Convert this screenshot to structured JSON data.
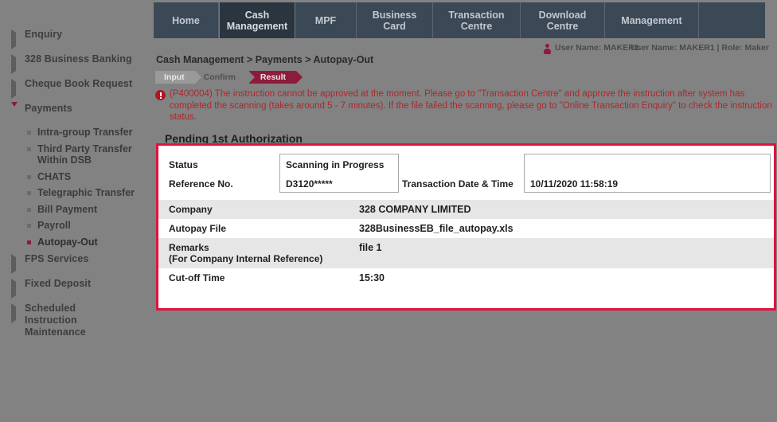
{
  "topnav": {
    "tabs": [
      {
        "label": "Home",
        "active": false
      },
      {
        "label": "Cash Management",
        "active": true
      },
      {
        "label": "MPF",
        "active": false
      },
      {
        "label": "Business Card",
        "active": false
      },
      {
        "label": "Transaction Centre",
        "active": false
      },
      {
        "label": "Download Centre",
        "active": false
      },
      {
        "label": "Management",
        "active": false
      }
    ]
  },
  "userbar": {
    "text_primary": "User Name: MAKER1",
    "text_secondary": "User Name: MAKER1 | Role: Maker",
    "icon": "user-icon"
  },
  "sidebar": {
    "items": [
      {
        "label": "Enquiry",
        "type": "group",
        "expanded": false
      },
      {
        "label": "328 Business Banking",
        "type": "group",
        "expanded": false
      },
      {
        "label": "Cheque Book Request",
        "type": "group",
        "expanded": false
      },
      {
        "label": "Payments",
        "type": "group",
        "expanded": true
      },
      {
        "label": "Intra-group Transfer",
        "type": "sub",
        "active": false
      },
      {
        "label": "Third Party Transfer Within DSB",
        "type": "sub",
        "active": false
      },
      {
        "label": "CHATS",
        "type": "sub",
        "active": false
      },
      {
        "label": "Telegraphic Transfer",
        "type": "sub",
        "active": false
      },
      {
        "label": "Bill Payment",
        "type": "sub",
        "active": false
      },
      {
        "label": "Payroll",
        "type": "sub",
        "active": false
      },
      {
        "label": "Autopay-Out",
        "type": "sub",
        "active": true
      },
      {
        "label": "FPS Services",
        "type": "group",
        "expanded": false
      },
      {
        "label": "Fixed Deposit",
        "type": "group",
        "expanded": false
      },
      {
        "label": "Scheduled Instruction Maintenance",
        "type": "group",
        "expanded": false
      }
    ]
  },
  "content": {
    "breadcrumb": "Cash Management > Payments > Autopay-Out",
    "steps": [
      {
        "label": "Input",
        "state": "done"
      },
      {
        "label": "Confirm",
        "state": "plain"
      },
      {
        "label": "Result",
        "state": "current"
      }
    ],
    "alert": {
      "icon": "error-icon",
      "message": "(P400004) The instruction cannot be approved at the moment. Please go to \"Transaction Centre\" and approve the instruction after system has completed the scanning (takes around 5 - 7 minutes). If the file failed the scanning, please go to \"Online Transaction Enquiry\" to check the instruction status."
    },
    "section_title": "Pending 1st Authorization"
  },
  "panel": {
    "border_color": "#e0123c",
    "summary": {
      "status_label": "Status",
      "status_value": "Scanning in Progress",
      "reference_label": "Reference No.",
      "reference_value": "D3120*****",
      "txn_datetime_label": "Transaction Date & Time",
      "txn_datetime_value": "10/11/2020 11:58:19"
    },
    "rows": [
      {
        "label": "Company",
        "sublabel": "",
        "value": "328 COMPANY LIMITED",
        "shade": true
      },
      {
        "label": "Autopay File",
        "sublabel": "",
        "value": "328BusinessEB_file_autopay.xls",
        "shade": false
      },
      {
        "label": "Remarks",
        "sublabel": "(For Company Internal Reference)",
        "value": "file 1",
        "shade": true
      },
      {
        "label": "Cut-off Time",
        "sublabel": "",
        "value": "15:30",
        "shade": false
      }
    ]
  }
}
